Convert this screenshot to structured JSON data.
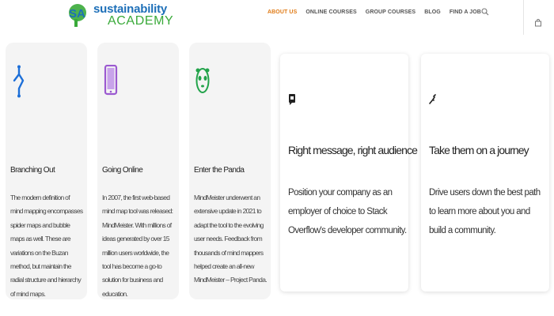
{
  "brand": {
    "line1": "sustainability",
    "line2": "ACADEMY",
    "mark": "SA"
  },
  "nav": {
    "items": [
      {
        "label": "ABOUT US",
        "active": true
      },
      {
        "label": "ONLINE COURSES",
        "active": false
      },
      {
        "label": "GROUP COURSES",
        "active": false
      },
      {
        "label": "BLOG",
        "active": false
      },
      {
        "label": "FIND A JOB",
        "active": false
      }
    ],
    "search_icon": "search-icon",
    "cart_icon": "shopping-bag-icon"
  },
  "colors": {
    "accent": "#e07b16",
    "brand_blue": "#1d6fb8",
    "brand_green": "#3aaa3a"
  },
  "features": [
    {
      "icon": "branch-icon",
      "title": "Branching Out",
      "body": "The modern definition of mind mapping encompasses spider maps and bubble maps as well. These are variations on the Buzan method, but maintain the radial structure and hierarchy of mind maps."
    },
    {
      "icon": "tablet-icon",
      "title": "Going Online",
      "body": "In 2007, the first web-based mind map tool was released: MindMeister. With millions of ideas generated by over 15 million users worldwide, the tool has become a go-to solution for business and education."
    },
    {
      "icon": "panda-icon",
      "title": "Enter the Panda",
      "body": "MindMeister underwent an extensive update in 2021 to adapt the tool to the evolving user needs. Feedback from thousands of mind mappers helped create an all-new MindMeister – Project Panda."
    }
  ],
  "promos": [
    {
      "icon": "message-icon",
      "title": "Right message, right audience",
      "body": "Position your company as an employer of choice to Stack Overflow's developer community."
    },
    {
      "icon": "path-icon",
      "title": "Take them on a journey",
      "body": "Drive users down the best path to learn more about you and build a community."
    }
  ]
}
